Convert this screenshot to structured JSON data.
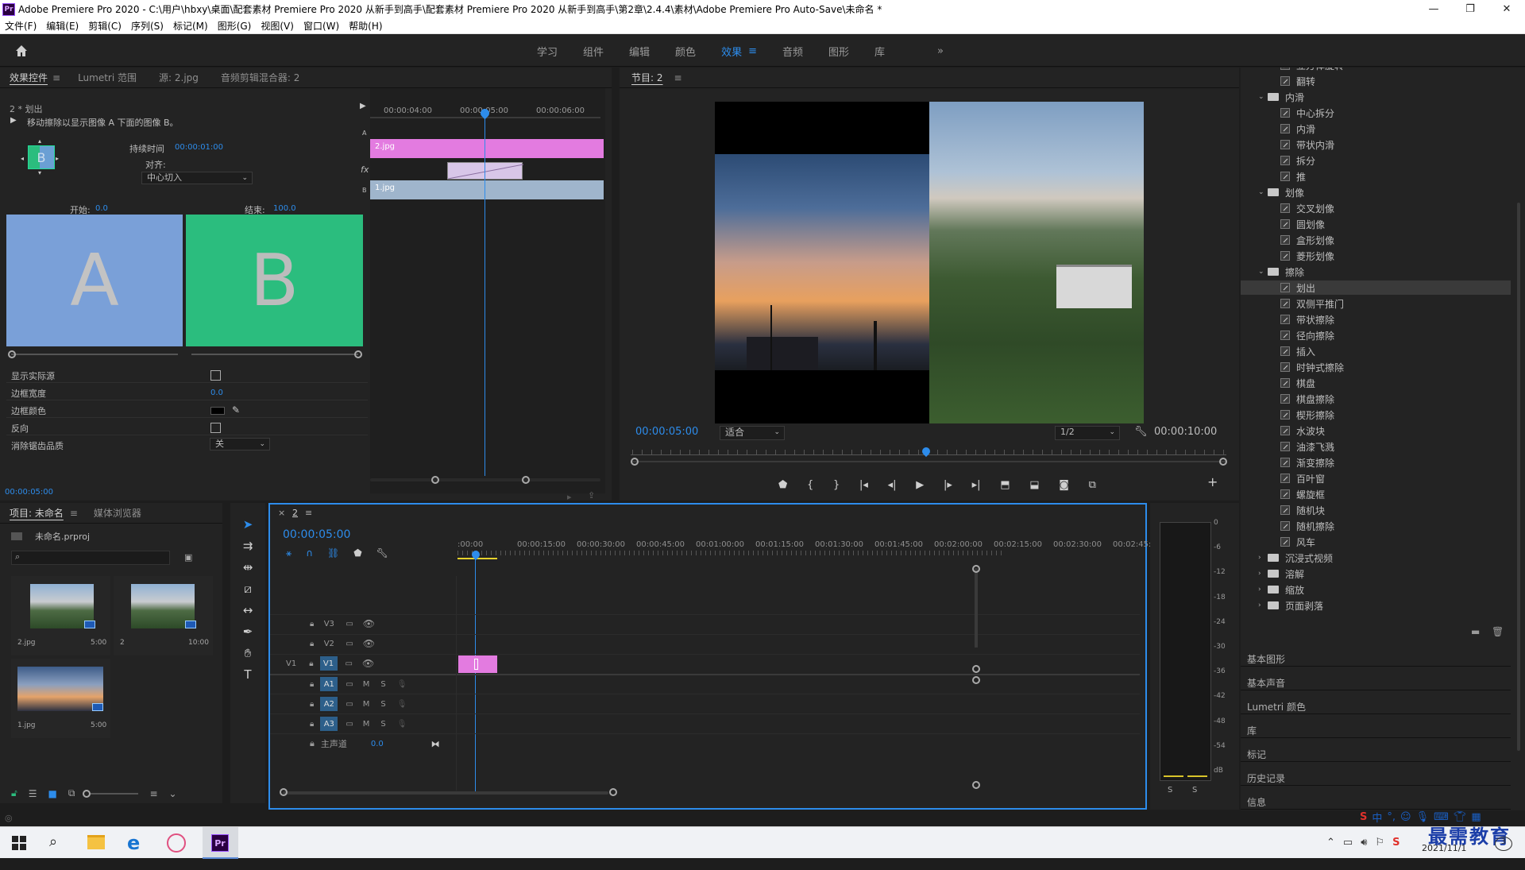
{
  "titlebar": {
    "app_badge": "Pr",
    "title": "Adobe Premiere Pro 2020 - C:\\用户\\hbxy\\桌面\\配套素材 Premiere Pro 2020 从新手到高手\\配套素材 Premiere Pro 2020 从新手到高手\\第2章\\2.4.4\\素材\\Adobe Premiere Pro Auto-Save\\未命名 *",
    "min": "—",
    "max": "❐",
    "close": "✕"
  },
  "menu": [
    "文件(F)",
    "编辑(E)",
    "剪辑(C)",
    "序列(S)",
    "标记(M)",
    "图形(G)",
    "视图(V)",
    "窗口(W)",
    "帮助(H)"
  ],
  "workspaces": {
    "tabs": [
      "学习",
      "组件",
      "编辑",
      "颜色",
      "效果",
      "音频",
      "图形",
      "库"
    ],
    "active_index": 4,
    "more": "»",
    "menu_icon": "≡"
  },
  "effect_controls": {
    "tabs": [
      "效果控件",
      "Lumetri 范围",
      "源: 2.jpg",
      "音频剪辑混合器: 2"
    ],
    "menu_icon": "≡",
    "clip_name": "2 * 划出",
    "description": "移动擦除以显示图像 A 下面的图像 B。",
    "duration_label": "持续时间",
    "duration_value": "00:00:01:00",
    "align_label": "对齐:",
    "align_value": "中心切入",
    "start_label": "开始:",
    "start_value": "0.0",
    "end_label": "结束:",
    "end_value": "100.0",
    "preview_a": "A",
    "preview_b": "B",
    "preview_thumb": "B",
    "props": [
      {
        "label": "显示实际源",
        "type": "checkbox"
      },
      {
        "label": "边框宽度",
        "type": "value",
        "value": "0.0"
      },
      {
        "label": "边框颜色",
        "type": "color"
      },
      {
        "label": "反向",
        "type": "checkbox"
      },
      {
        "label": "消除锯齿品质",
        "type": "select",
        "value": "关"
      }
    ],
    "timecode": "00:00:05:00",
    "mini_ruler": [
      "00:00:04:00",
      "00:00:05:00",
      "00:00:06:00"
    ],
    "clip_a": "2.jpg",
    "clip_b": "1.jpg",
    "track_a": "A",
    "track_b": "B",
    "fx": "fx"
  },
  "program_monitor": {
    "title": "节目: 2",
    "menu_icon": "≡",
    "timecode": "00:00:05:00",
    "fit": "适合",
    "resolution": "1/2",
    "duration": "00:00:10:00"
  },
  "effects_tree": {
    "items": [
      {
        "kind": "effect",
        "label": "立方体旋转",
        "level": 2
      },
      {
        "kind": "effect",
        "label": "翻转",
        "level": 2
      },
      {
        "kind": "folder",
        "label": "内滑",
        "level": 1,
        "open": true
      },
      {
        "kind": "effect",
        "label": "中心拆分",
        "level": 2
      },
      {
        "kind": "effect",
        "label": "内滑",
        "level": 2
      },
      {
        "kind": "effect",
        "label": "带状内滑",
        "level": 2
      },
      {
        "kind": "effect",
        "label": "拆分",
        "level": 2
      },
      {
        "kind": "effect",
        "label": "推",
        "level": 2
      },
      {
        "kind": "folder",
        "label": "划像",
        "level": 1,
        "open": true
      },
      {
        "kind": "effect",
        "label": "交叉划像",
        "level": 2
      },
      {
        "kind": "effect",
        "label": "圆划像",
        "level": 2
      },
      {
        "kind": "effect",
        "label": "盒形划像",
        "level": 2
      },
      {
        "kind": "effect",
        "label": "菱形划像",
        "level": 2
      },
      {
        "kind": "folder",
        "label": "擦除",
        "level": 1,
        "open": true
      },
      {
        "kind": "effect",
        "label": "划出",
        "level": 2,
        "selected": true
      },
      {
        "kind": "effect",
        "label": "双侧平推门",
        "level": 2
      },
      {
        "kind": "effect",
        "label": "带状擦除",
        "level": 2
      },
      {
        "kind": "effect",
        "label": "径向擦除",
        "level": 2
      },
      {
        "kind": "effect",
        "label": "插入",
        "level": 2
      },
      {
        "kind": "effect",
        "label": "时钟式擦除",
        "level": 2
      },
      {
        "kind": "effect",
        "label": "棋盘",
        "level": 2
      },
      {
        "kind": "effect",
        "label": "棋盘擦除",
        "level": 2
      },
      {
        "kind": "effect",
        "label": "楔形擦除",
        "level": 2
      },
      {
        "kind": "effect",
        "label": "水波块",
        "level": 2
      },
      {
        "kind": "effect",
        "label": "油漆飞溅",
        "level": 2
      },
      {
        "kind": "effect",
        "label": "渐变擦除",
        "level": 2
      },
      {
        "kind": "effect",
        "label": "百叶窗",
        "level": 2
      },
      {
        "kind": "effect",
        "label": "螺旋框",
        "level": 2
      },
      {
        "kind": "effect",
        "label": "随机块",
        "level": 2
      },
      {
        "kind": "effect",
        "label": "随机擦除",
        "level": 2
      },
      {
        "kind": "effect",
        "label": "风车",
        "level": 2
      },
      {
        "kind": "folder",
        "label": "沉浸式视频",
        "level": 1,
        "open": false
      },
      {
        "kind": "folder",
        "label": "溶解",
        "level": 1,
        "open": false
      },
      {
        "kind": "folder",
        "label": "缩放",
        "level": 1,
        "open": false
      },
      {
        "kind": "folder",
        "label": "页面剥落",
        "level": 1,
        "open": false
      }
    ],
    "collapsed_panels": [
      "基本图形",
      "基本声音",
      "Lumetri 颜色",
      "库",
      "标记",
      "历史记录",
      "信息"
    ]
  },
  "project": {
    "tabs": [
      "项目: 未命名",
      "媒体浏览器"
    ],
    "menu_icon": "≡",
    "file": "未命名.prproj",
    "items": [
      {
        "name": "2.jpg",
        "duration": "5:00"
      },
      {
        "name": "2",
        "duration": "10:00"
      },
      {
        "name": "1.jpg",
        "duration": "5:00"
      }
    ]
  },
  "timeline": {
    "tab": "2",
    "close": "×",
    "menu_icon": "≡",
    "timecode": "00:00:05:00",
    "ruler": [
      ":00:00",
      "00:00:15:00",
      "00:00:30:00",
      "00:00:45:00",
      "00:01:00:00",
      "00:01:15:00",
      "00:01:30:00",
      "00:01:45:00",
      "00:02:00:00",
      "00:02:15:00",
      "00:02:30:00",
      "00:02:45:"
    ],
    "video_tracks": [
      "V3",
      "V2",
      "V1"
    ],
    "v1_source": "V1",
    "audio_tracks": [
      "A1",
      "A2",
      "A3"
    ],
    "m": "M",
    "s": "S",
    "master_label": "主声道",
    "master_value": "0.0"
  },
  "meter": {
    "labels": [
      "0",
      "-6",
      "-12",
      "-18",
      "-24",
      "-30",
      "-36",
      "-42",
      "-48",
      "-54",
      "dB"
    ],
    "buttons": [
      "S",
      "S"
    ]
  },
  "taskbar": {
    "ime": "中",
    "date": "2021/11/1",
    "watermark": "最需教育"
  }
}
